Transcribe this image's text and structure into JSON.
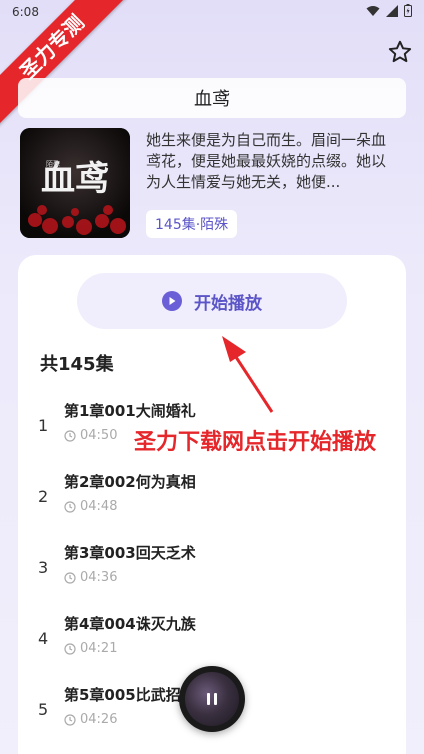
{
  "status": {
    "time": "6:08"
  },
  "watermark": {
    "ribbon_text": "圣力专测"
  },
  "header": {
    "title": "血鸢"
  },
  "book": {
    "description": "她生来便是为自己而生。眉间一朵血鸢花，便是她最最妖娆的点缀。她以为人生情爱与她无关，她便...",
    "tag": "145集·陌殊",
    "cover_text": "血鸢",
    "cover_small": "陌殊"
  },
  "player": {
    "play_label": "开始播放",
    "episode_count": "共145集"
  },
  "annotation": {
    "text": "圣力下载网点击开始播放"
  },
  "episodes": [
    {
      "num": "1",
      "title": "第1章001大闹婚礼",
      "duration": "04:50"
    },
    {
      "num": "2",
      "title": "第2章002何为真相",
      "duration": "04:48"
    },
    {
      "num": "3",
      "title": "第3章003回天乏术",
      "duration": "04:36"
    },
    {
      "num": "4",
      "title": "第4章004诛灭九族",
      "duration": "04:21"
    },
    {
      "num": "5",
      "title": "第5章005比武招",
      "duration": "04:26"
    }
  ],
  "colors": {
    "accent": "#5b55c8",
    "annotation": "#e5262a",
    "ribbon": "#e5262a"
  },
  "icons": [
    "star-icon",
    "play-icon",
    "clock-icon",
    "pause-icon",
    "wifi-icon",
    "signal-icon",
    "battery-icon"
  ]
}
